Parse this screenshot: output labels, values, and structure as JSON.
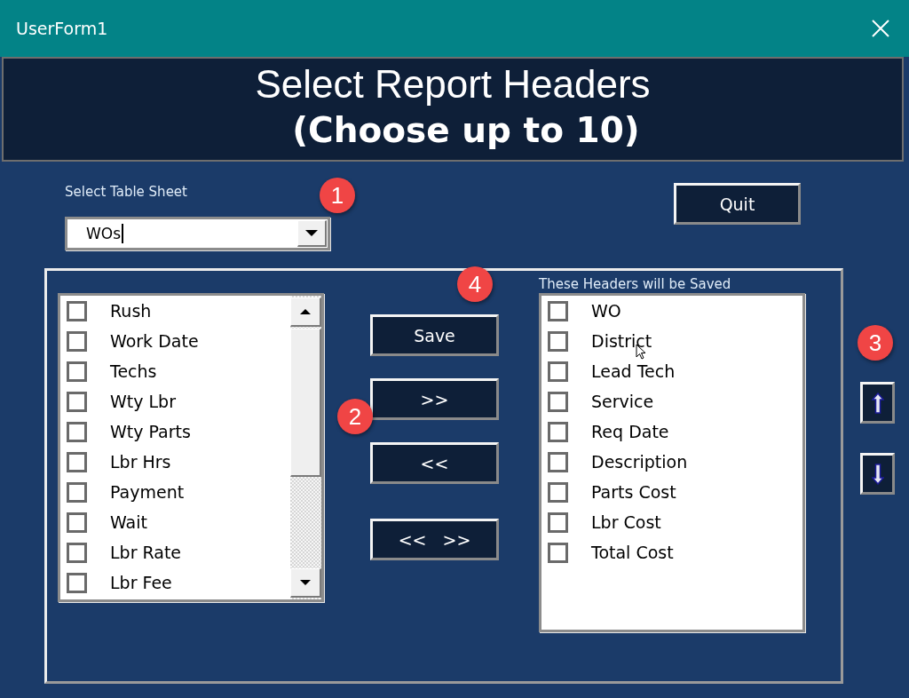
{
  "window": {
    "title": "UserForm1"
  },
  "header": {
    "title": "Select Report Headers",
    "subtitle": "(Choose up to 10)"
  },
  "sheet_select": {
    "label": "Select Table Sheet",
    "value": "WOs"
  },
  "quit_button": "Quit",
  "available_list": {
    "items": [
      {
        "label": "Rush",
        "checked": false
      },
      {
        "label": "Work Date",
        "checked": false
      },
      {
        "label": "Techs",
        "checked": false
      },
      {
        "label": "Wty Lbr",
        "checked": false
      },
      {
        "label": "Wty Parts",
        "checked": false
      },
      {
        "label": "Lbr Hrs",
        "checked": false
      },
      {
        "label": "Payment",
        "checked": false
      },
      {
        "label": "Wait",
        "checked": false
      },
      {
        "label": "Lbr Rate",
        "checked": false
      },
      {
        "label": "Lbr Fee",
        "checked": false
      }
    ]
  },
  "transfer_buttons": [
    "Save",
    ">>",
    "<<",
    "<< >>"
  ],
  "saved_list": {
    "label": "These Headers will be Saved",
    "items": [
      {
        "label": "WO",
        "checked": false
      },
      {
        "label": "District",
        "checked": false
      },
      {
        "label": "Lead Tech",
        "checked": false
      },
      {
        "label": "Service",
        "checked": false
      },
      {
        "label": "Req Date",
        "checked": false
      },
      {
        "label": "Description",
        "checked": false
      },
      {
        "label": "Parts Cost",
        "checked": false
      },
      {
        "label": "Lbr Cost",
        "checked": false
      },
      {
        "label": "Total Cost",
        "checked": false
      }
    ]
  },
  "callouts": [
    "1",
    "2",
    "3",
    "4"
  ]
}
